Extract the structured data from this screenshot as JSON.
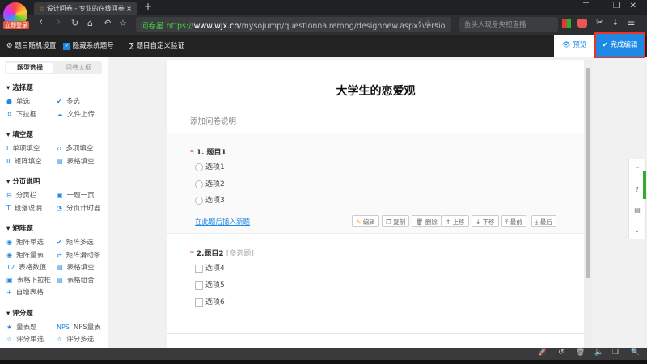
{
  "browser": {
    "tab_title": "设计问卷 - 专业的在线问卷",
    "new_tab": "+",
    "login_badge": "立即登录",
    "url_site": "问卷星",
    "url_scheme": "https://",
    "url_host": "www.wjx.cn",
    "url_path": "/mysojump/questionnairemng/designnew.aspx?versio",
    "search_placeholder": "鱼头人现身央视直播"
  },
  "toolbar": {
    "random": "题目随机设置",
    "hide_numbers": "隐藏系统题号",
    "custom_validation": "题目自定义验证",
    "preview": "预览",
    "finish": "完成编辑"
  },
  "sidebar": {
    "tabs": [
      "题型选择",
      "问卷大纲"
    ],
    "groups": [
      {
        "title": "选择题",
        "items": [
          "单选",
          "多选",
          "下拉框",
          "文件上传"
        ]
      },
      {
        "title": "填空题",
        "items": [
          "单项填空",
          "多项填空",
          "矩阵填空",
          "表格填空"
        ]
      },
      {
        "title": "分页说明",
        "items": [
          "分页栏",
          "一题一页",
          "段落说明",
          "分页计时器"
        ]
      },
      {
        "title": "矩阵题",
        "items": [
          "矩阵单选",
          "矩阵多选",
          "矩阵量表",
          "矩阵滑动条",
          "表格数值",
          "表格填空",
          "表格下拉框",
          "表格组合",
          "自增表格"
        ]
      },
      {
        "title": "评分题",
        "items": [
          "量表题",
          "NPS量表",
          "评分单选",
          "评分多选"
        ]
      }
    ]
  },
  "survey": {
    "title": "大学生的恋爱观",
    "description": "添加问卷说明",
    "q1": {
      "label": "1. 题目1",
      "options": [
        "选项1",
        "选项2",
        "选项3"
      ],
      "insert_link": "在此题后插入新题",
      "actions": [
        "编辑",
        "复制",
        "删除",
        "上移",
        "下移",
        "最前",
        "最后"
      ]
    },
    "q2": {
      "label": "2.题目2",
      "tag": "[多选题]",
      "options": [
        "选项4",
        "选项5",
        "选项6"
      ]
    }
  }
}
